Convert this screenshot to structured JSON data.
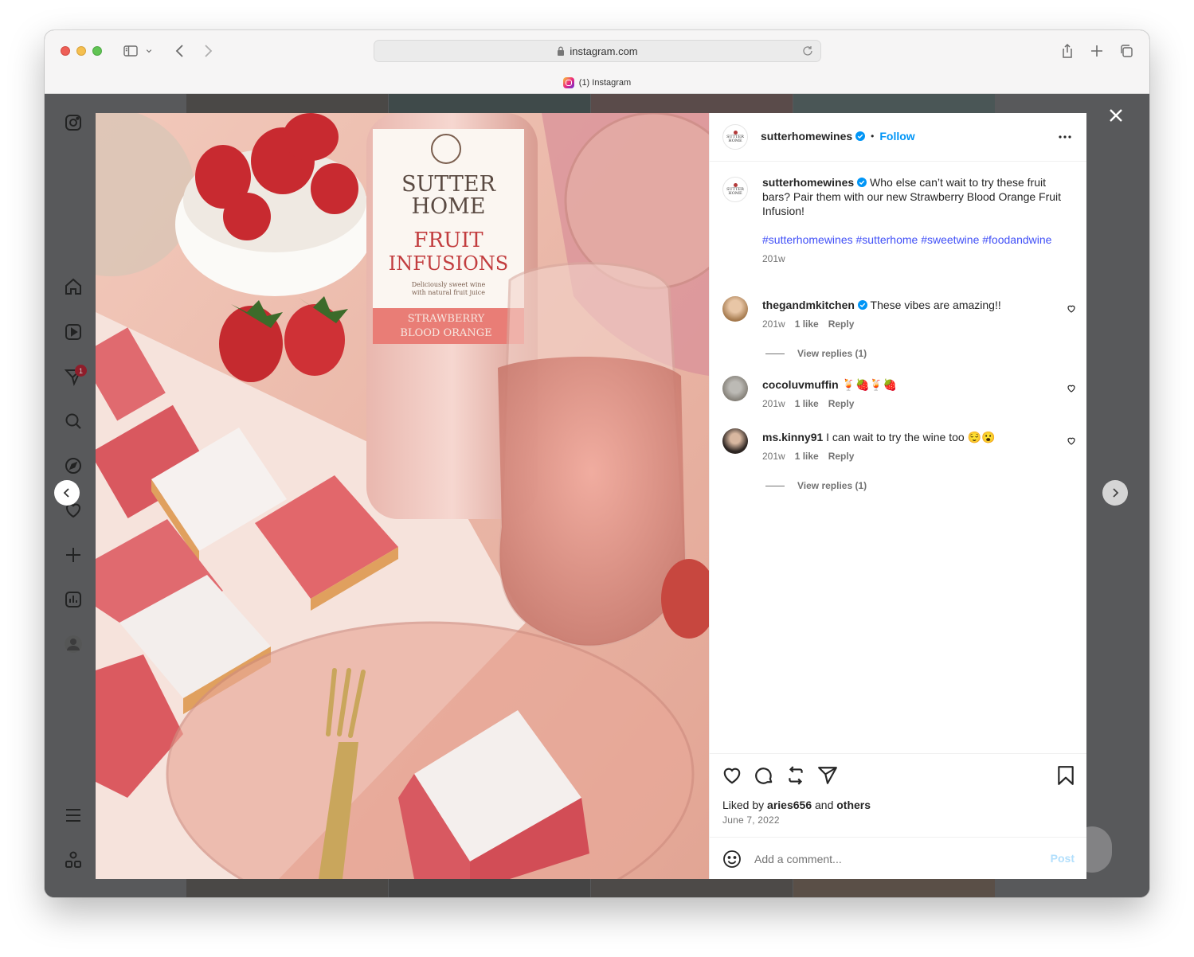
{
  "browser": {
    "url": "instagram.com",
    "tab_title": "(1) Instagram"
  },
  "sidebar": {
    "notification_count": "1"
  },
  "post": {
    "author": "sutterhomewines",
    "follow_label": "Follow",
    "separator": "•",
    "caption": "Who else can’t wait to try these fruit bars? Pair them with our new Strawberry Blood Orange Fruit Infusion!",
    "hashtags": "#sutterhomewines #sutterhome #sweetwine #foodandwine",
    "caption_age": "201w",
    "brand_avatar_text_1": "SUTTER",
    "brand_avatar_text_2": "HOME",
    "liked_by_prefix": "Liked by",
    "liked_by_user": "aries656",
    "liked_by_and": "and",
    "liked_by_others": "others",
    "date": "June 7, 2022"
  },
  "comments": [
    {
      "user": "thegandmkitchen",
      "text": "These vibes are amazing!!",
      "age": "201w",
      "likes": "1 like",
      "reply": "Reply",
      "view_replies": "View replies (1)"
    },
    {
      "user": "cocoluvmuffin",
      "text": "🍹🍓🍹🍓",
      "age": "201w",
      "likes": "1 like",
      "reply": "Reply"
    },
    {
      "user": "ms.kinny91",
      "text": "I can wait to try the wine too 😌😮",
      "age": "201w",
      "likes": "1 like",
      "reply": "Reply",
      "view_replies": "View replies (1)"
    }
  ],
  "comment_box": {
    "placeholder": "Add a comment...",
    "post_label": "Post"
  },
  "photo": {
    "bottle_brand_1": "SUTTER",
    "bottle_brand_2": "HOME",
    "bottle_line_1": "FRUIT",
    "bottle_line_2": "INFUSIONS",
    "bottle_tag_1": "Deliciously sweet wine",
    "bottle_tag_2": "with natural fruit juice",
    "bottle_flavor_1": "STRAWBERRY",
    "bottle_flavor_2": "BLOOD ORANGE"
  },
  "colors": {
    "accent": "#0095f6",
    "hashtag": "#4150f7",
    "post_disabled": "#b2dffc"
  }
}
